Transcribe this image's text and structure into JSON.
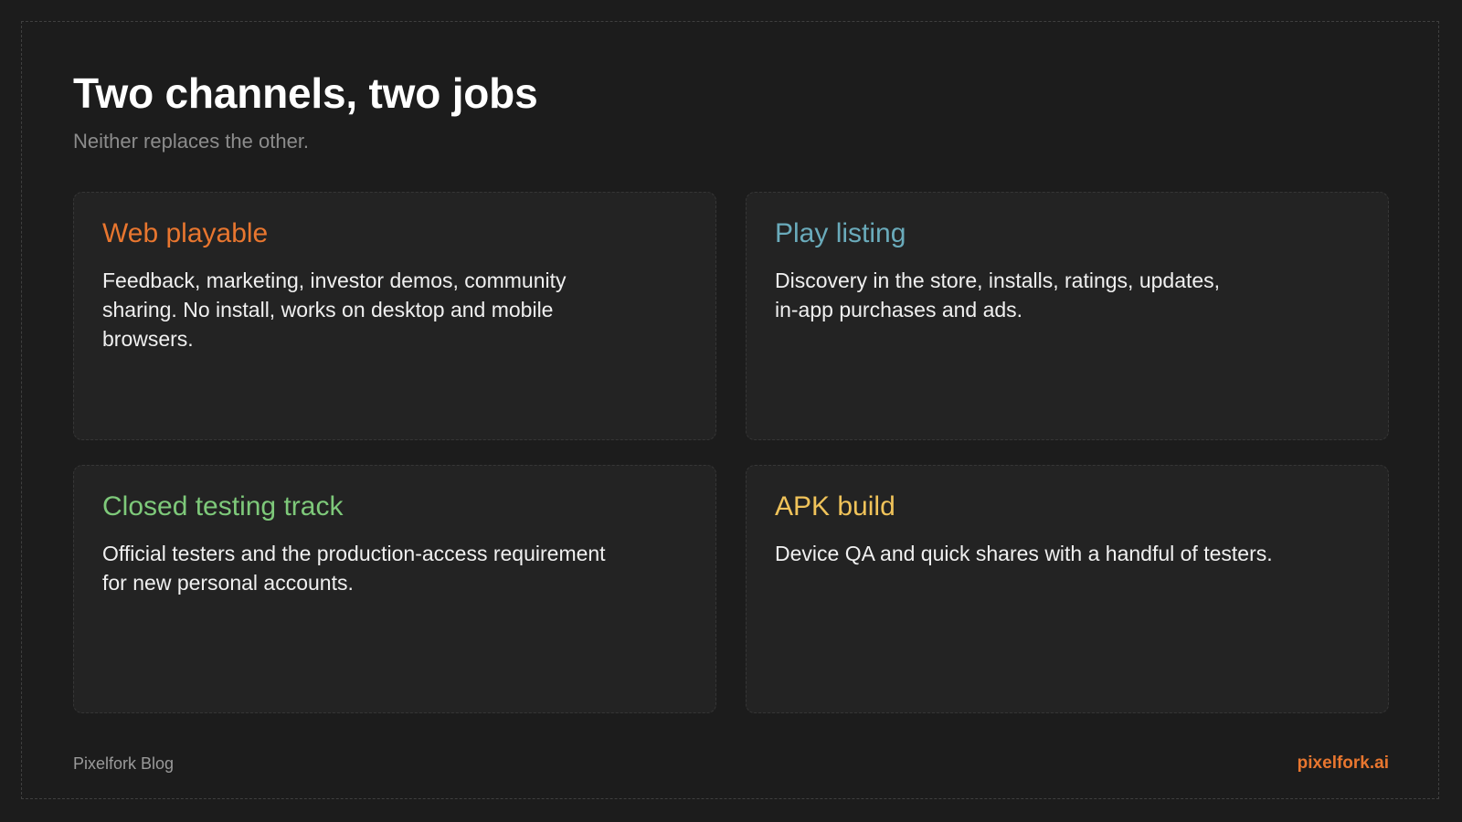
{
  "header": {
    "title": "Two channels, two jobs",
    "subtitle": "Neither replaces the other."
  },
  "cards": [
    {
      "title": "Web playable",
      "body": "Feedback, marketing, investor demos, community\nsharing. No install, works on desktop and mobile\nbrowsers.",
      "color": "#e8762f"
    },
    {
      "title": "Play listing",
      "body": "Discovery in the store, installs, ratings, updates,\nin-app purchases and ads.",
      "color": "#6aabbb"
    },
    {
      "title": "Closed testing track",
      "body": "Official testers and the production-access requirement\nfor new personal accounts.",
      "color": "#7ec97a"
    },
    {
      "title": "APK build",
      "body": "Device QA and quick shares with a handful of testers.",
      "color": "#f0c35a"
    }
  ],
  "footer": {
    "left": "Pixelfork Blog",
    "right": "pixelfork.ai",
    "right_color": "#e8762f"
  }
}
